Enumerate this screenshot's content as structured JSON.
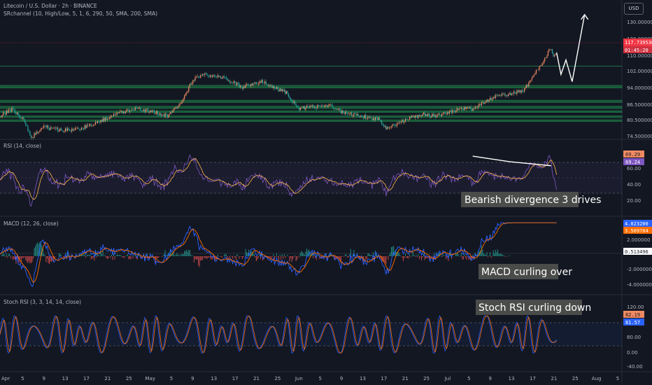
{
  "header": {
    "symbol_line": "Litecoin / U.S. Dollar · 2h · BINANCE",
    "indicator_line": "SRchannel (10, High/Low, 5, 1, 6, 290, 50, SMA, 200, SMA)"
  },
  "currency_button": "USD",
  "price_axis": {
    "ticks": [
      "130.000000",
      "120.000000",
      "110.000000",
      "102.000000",
      "94.000000",
      "86.500000",
      "80.500000",
      "74.500000"
    ],
    "price_tag": "117.739530",
    "timer_tag": "01:45:20"
  },
  "rsi": {
    "title": "RSI (14, close)",
    "ticks": [
      "80.00",
      "60.00",
      "40.00",
      "20.00"
    ],
    "tag_a": "69.29",
    "tag_b": "69.24"
  },
  "macd": {
    "title": "MACD (12, 26, close)",
    "ticks": [
      "2.000000",
      "0.000000",
      "-2.000000",
      "-4.000000"
    ],
    "tag_a": "4.023200",
    "tag_b": "3.509704",
    "tag_c": "0.513496"
  },
  "stoch": {
    "title": "Stoch RSI (3, 3, 14, 14, close)",
    "ticks": [
      "120.00",
      "80.00",
      "40.00",
      "0.00",
      "-40.00"
    ],
    "tag_a": "82.19",
    "tag_b": "81.57"
  },
  "time_axis": {
    "labels": [
      "Apr",
      "5",
      "9",
      "13",
      "17",
      "21",
      "25",
      "May",
      "5",
      "9",
      "13",
      "17",
      "21",
      "25",
      "Jun",
      "5",
      "9",
      "13",
      "17",
      "21",
      "25",
      "Jul",
      "5",
      "9",
      "13",
      "17",
      "21",
      "25",
      "Aug",
      "5"
    ]
  },
  "annotations": {
    "rsi_note": "Bearish divergence 3 drives",
    "macd_note": "MACD curling over",
    "stoch_note": "Stoch RSI curling down"
  },
  "colors": {
    "background": "#131722",
    "candle_up": "#ef8a62",
    "candle_down": "#26a69a",
    "sr_zone": "#1e8a4a",
    "price_tag": "#f23645",
    "rsi_line": "#7e57c2",
    "rsi_ma": "#ffb74d",
    "macd_line": "#2962ff",
    "signal_line": "#ff6d00",
    "stoch_k": "#2962ff",
    "stoch_d": "#ff6d00"
  },
  "chart_data": {
    "type": "candlestick",
    "timeframe": "2h",
    "price_range": [
      72,
      138
    ],
    "sr_levels": [
      [
        99.5,
        101.0
      ],
      [
        91.5,
        92.8
      ],
      [
        88.2,
        89.5
      ],
      [
        86.0,
        87.0
      ],
      [
        83.2,
        84.2
      ],
      [
        81.0,
        82.0
      ]
    ],
    "price_path": [
      [
        0,
        84
      ],
      [
        0.02,
        88
      ],
      [
        0.04,
        81
      ],
      [
        0.05,
        72
      ],
      [
        0.07,
        78
      ],
      [
        0.1,
        76
      ],
      [
        0.13,
        77
      ],
      [
        0.16,
        81
      ],
      [
        0.19,
        86
      ],
      [
        0.22,
        88
      ],
      [
        0.25,
        86
      ],
      [
        0.27,
        84
      ],
      [
        0.29,
        91
      ],
      [
        0.31,
        104
      ],
      [
        0.33,
        107
      ],
      [
        0.36,
        105
      ],
      [
        0.39,
        100
      ],
      [
        0.42,
        103
      ],
      [
        0.44,
        100
      ],
      [
        0.46,
        97
      ],
      [
        0.48,
        88
      ],
      [
        0.5,
        89
      ],
      [
        0.53,
        90
      ],
      [
        0.55,
        86
      ],
      [
        0.58,
        84
      ],
      [
        0.61,
        82
      ],
      [
        0.62,
        77
      ],
      [
        0.64,
        80
      ],
      [
        0.66,
        83
      ],
      [
        0.68,
        85
      ],
      [
        0.7,
        84
      ],
      [
        0.72,
        86
      ],
      [
        0.74,
        88
      ],
      [
        0.76,
        88
      ],
      [
        0.78,
        92
      ],
      [
        0.8,
        96
      ],
      [
        0.82,
        96
      ],
      [
        0.84,
        98
      ],
      [
        0.855,
        104
      ],
      [
        0.865,
        110
      ],
      [
        0.875,
        115
      ],
      [
        0.885,
        122
      ],
      [
        0.89,
        116
      ],
      [
        0.895,
        119
      ]
    ],
    "projection": [
      [
        0.895,
        119
      ],
      [
        0.902,
        107
      ],
      [
        0.91,
        115
      ],
      [
        0.92,
        103
      ],
      [
        0.94,
        140
      ]
    ],
    "rsi": {
      "range": [
        10,
        90
      ],
      "levels": [
        70,
        50,
        30
      ],
      "divergence_points": [
        [
          0.76,
          82
        ],
        [
          0.82,
          75
        ],
        [
          0.86,
          72
        ]
      ],
      "last": 69.29
    },
    "macd": {
      "range": [
        -5,
        5
      ],
      "last_macd": 4.0232,
      "last_signal": 3.509704,
      "last_hist": 0.513496
    },
    "stoch_rsi": {
      "range": [
        -45,
        125
      ],
      "levels": [
        80,
        20
      ],
      "last_k": 82.19,
      "last_d": 81.57
    }
  }
}
